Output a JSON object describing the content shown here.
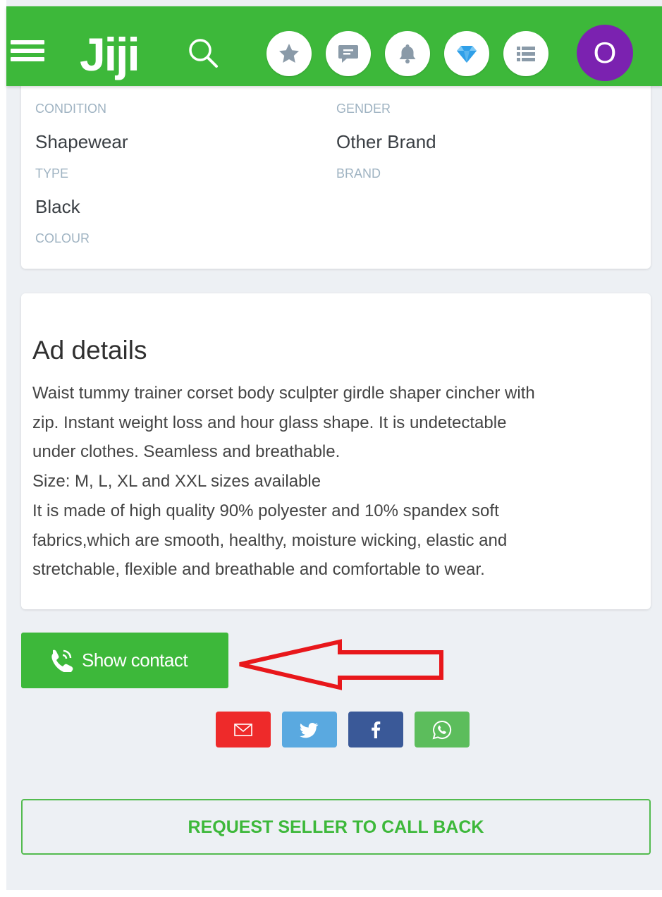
{
  "header": {
    "logo_text": "Jiji",
    "menu_icon": "hamburger-icon",
    "search_icon": "search-icon",
    "icons": [
      "star-icon",
      "chat-icon",
      "bell-icon",
      "diamond-icon",
      "list-icon"
    ],
    "avatar_letter": "O",
    "brand_color": "#3db83a",
    "avatar_color": "#7b22b0"
  },
  "attributes": [
    {
      "value": "",
      "label": "CONDITION"
    },
    {
      "value": "Shapewear",
      "label": "TYPE"
    },
    {
      "value": "Black",
      "label": "COLOUR"
    },
    {
      "value": "",
      "label": "GENDER"
    },
    {
      "value": "Other Brand",
      "label": "BRAND"
    }
  ],
  "details": {
    "title": "Ad details",
    "lines": [
      "Waist tummy trainer corset body sculpter girdle shaper cincher with",
      "zip. Instant weight loss and hour glass shape. It is undetectable",
      "under clothes. Seamless and breathable.",
      "Size: M, L, XL and XXL sizes available",
      "It is made of high quality 90% polyester and 10% spandex soft",
      "fabrics,which are smooth, healthy, moisture wicking, elastic and",
      "stretchable, flexible and breathable and comfortable to wear."
    ]
  },
  "contact": {
    "show_label": "Show contact",
    "icon": "phone-icon",
    "annotation": "red-arrow-pointing-left"
  },
  "share": [
    {
      "icon": "mail-icon",
      "color": "#ee2a2a"
    },
    {
      "icon": "twitter-icon",
      "color": "#5aa9e0"
    },
    {
      "icon": "facebook-icon",
      "color": "#3a5998"
    },
    {
      "icon": "whatsapp-icon",
      "color": "#5cbd5c"
    }
  ],
  "callback": {
    "label": "REQUEST SELLER TO CALL BACK"
  }
}
